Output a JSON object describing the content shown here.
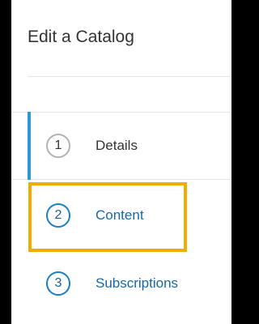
{
  "header": {
    "title": "Edit a Catalog"
  },
  "steps": [
    {
      "number": "1",
      "label": "Details",
      "state": "current"
    },
    {
      "number": "2",
      "label": "Content",
      "state": "link"
    },
    {
      "number": "3",
      "label": "Subscriptions",
      "state": "link"
    }
  ],
  "colors": {
    "active_indicator": "#2a99d6",
    "link": "#1569a8",
    "highlight": "#f0ad00"
  }
}
